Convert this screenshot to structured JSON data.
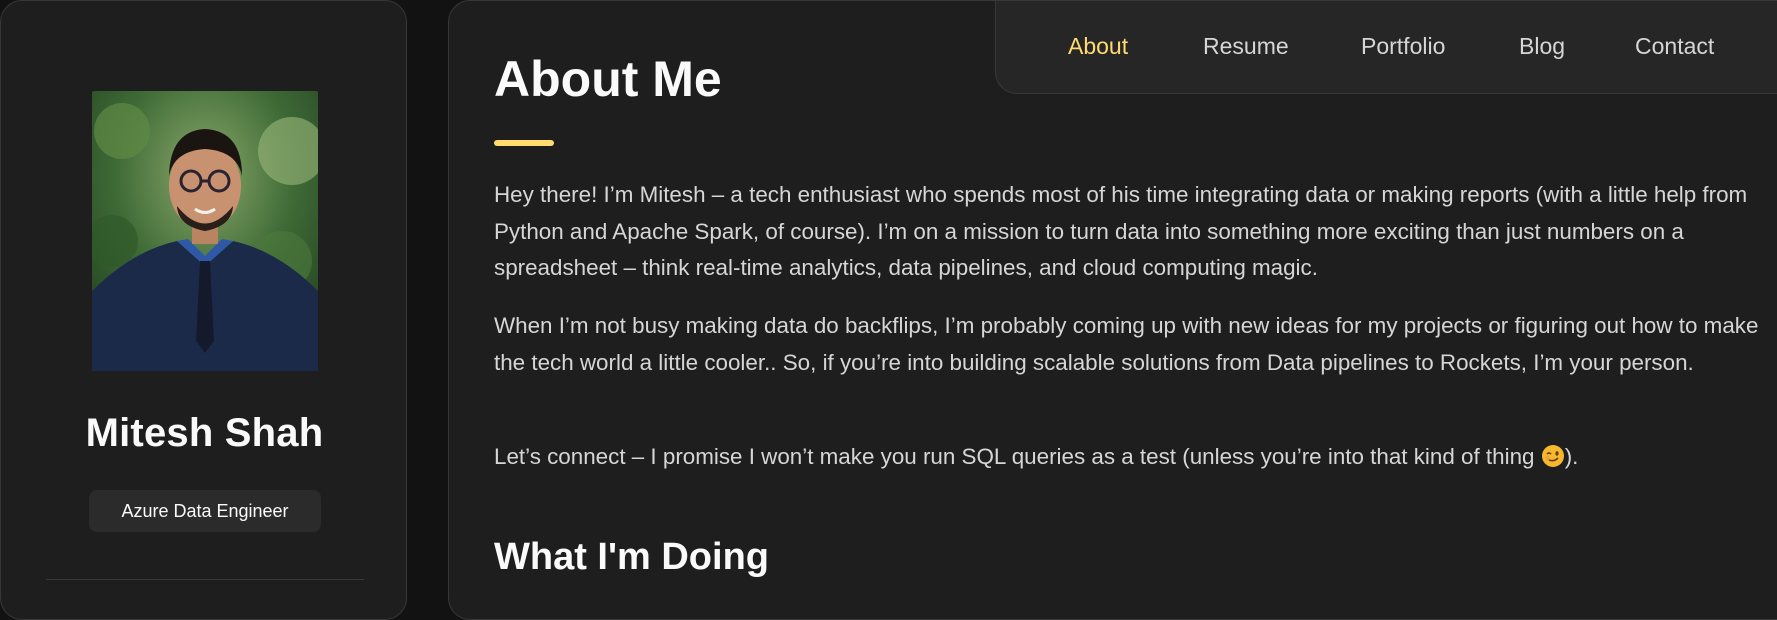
{
  "profile": {
    "name": "Mitesh Shah",
    "title": "Azure Data Engineer"
  },
  "nav": {
    "items": [
      {
        "label": "About",
        "active": true
      },
      {
        "label": "Resume",
        "active": false
      },
      {
        "label": "Portfolio",
        "active": false
      },
      {
        "label": "Blog",
        "active": false
      },
      {
        "label": "Contact",
        "active": false
      }
    ]
  },
  "about": {
    "heading": "About Me",
    "paragraphs": [
      "Hey there! I’m Mitesh – a tech enthusiast who spends most of his time integrating data or making reports (with a little help from Python and Apache Spark, of course). I’m on a mission to turn data into something more exciting than just numbers on a spreadsheet – think real-time analytics, data pipelines, and cloud computing magic.",
      "When I’m not busy making data do backflips, I’m probably coming up with new ideas for my projects or figuring out how to make the tech world a little cooler.. So, if you’re into building scalable solutions from Data pipelines to Rockets, I’m your person.",
      "Let’s connect – I promise I won’t make you run SQL queries as a test (unless you’re into that kind of thing "
    ],
    "paragraph3_end": ").",
    "section_heading": "What I'm Doing"
  },
  "icons": {
    "emoji": "winking-face-icon"
  },
  "colors": {
    "accent": "#ffdb70",
    "panel": "#1e1e1f",
    "background": "#121212"
  }
}
